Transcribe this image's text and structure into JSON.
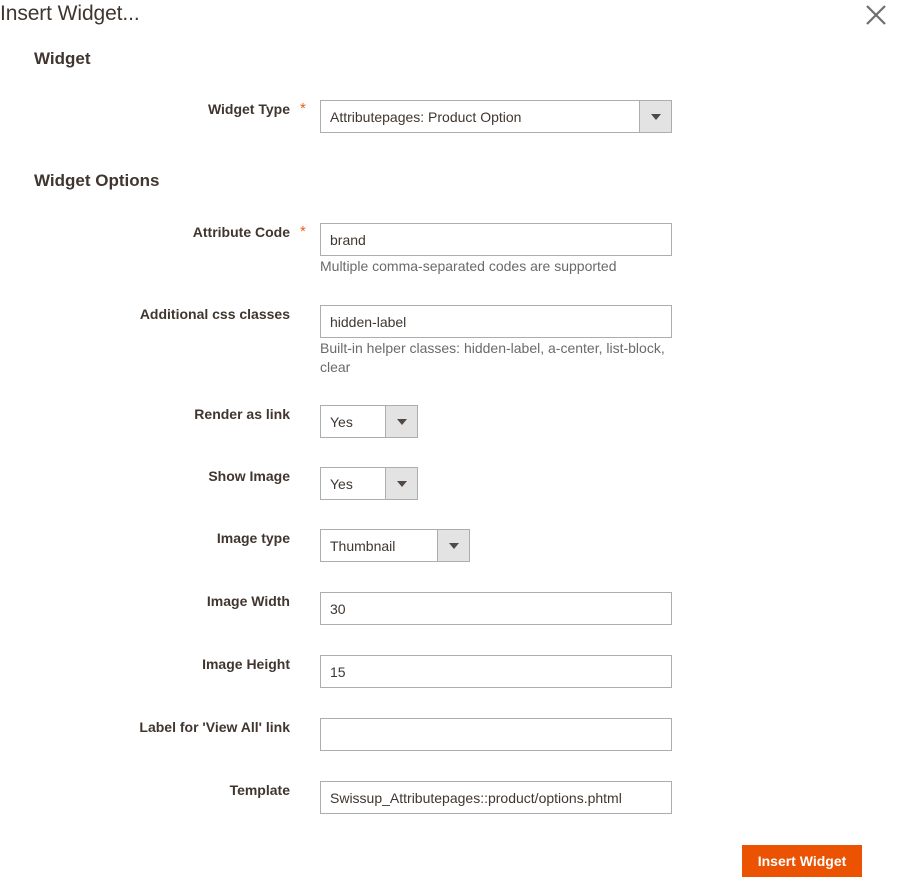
{
  "modal": {
    "title": "Insert Widget...",
    "close_icon": "close-icon",
    "close_label": "Close"
  },
  "sections": {
    "widget": "Widget",
    "widget_options": "Widget Options"
  },
  "widget_type": {
    "label": "Widget Type",
    "required_marker": "*",
    "value": "Attributepages: Product Option"
  },
  "fields": {
    "attribute_code": {
      "label": "Attribute Code",
      "required_marker": "*",
      "value": "brand",
      "placeholder": "",
      "helper": "Multiple comma-separated codes are supported"
    },
    "additional_css_classes": {
      "label": "Additional css classes",
      "value": "hidden-label",
      "placeholder": "",
      "helper": "Built-in helper classes: hidden-label, a-center, list-block, clear"
    },
    "render_as_link": {
      "label": "Render as link",
      "value": "Yes"
    },
    "show_image": {
      "label": "Show Image",
      "value": "Yes"
    },
    "image_type": {
      "label": "Image type",
      "value": "Thumbnail"
    },
    "image_width": {
      "label": "Image Width",
      "value": "30",
      "placeholder": ""
    },
    "image_height": {
      "label": "Image Height",
      "value": "15",
      "placeholder": ""
    },
    "view_all_label": {
      "label": "Label for 'View All' link",
      "value": "",
      "placeholder": ""
    },
    "template": {
      "label": "Template",
      "value": "Swissup_Attributepages::product/options.phtml",
      "placeholder": ""
    }
  },
  "footer": {
    "insert_label": "Insert Widget"
  },
  "colors": {
    "accent": "#eb5202",
    "required": "#e85d22",
    "heading": "#41362f",
    "helper": "#6a6a6a",
    "border": "#adadad"
  }
}
